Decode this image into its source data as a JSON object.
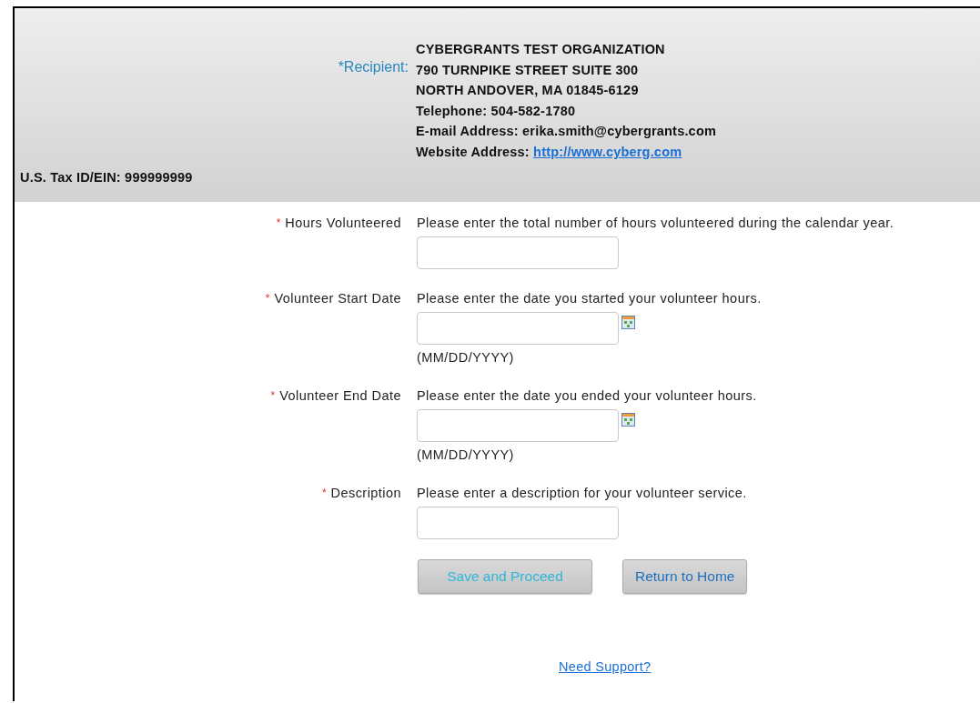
{
  "header": {
    "recipient_label": "*Recipient:",
    "address_lines": [
      "CYBERGRANTS TEST ORGANIZATION",
      "790 TURNPIKE STREET SUITE 300",
      "NORTH ANDOVER, MA 01845-6129",
      "Telephone: 504-582-1780",
      "E-mail Address: erika.smith@cybergrants.com"
    ],
    "website": {
      "label": "Website Address:",
      "link": "http://www.cyberg.com"
    },
    "tax_id": "U.S. Tax ID/EIN: 999999999"
  },
  "fields": [
    {
      "kind": "text",
      "required_mark": "*",
      "label": "Hours Volunteered",
      "instruction": "Please enter the total number of hours volunteered during the calendar year."
    },
    {
      "kind": "date",
      "required_mark": "*",
      "label": "Volunteer Start Date",
      "instruction": "Please enter the date you started your volunteer hours.",
      "format_hint": "(MM/DD/YYYY)"
    },
    {
      "kind": "date",
      "required_mark": "*",
      "label": "Volunteer End Date",
      "instruction": "Please enter the date you ended your volunteer hours.",
      "format_hint": "(MM/DD/YYYY)"
    },
    {
      "kind": "text",
      "required_mark": "*",
      "label": "Description",
      "instruction": "Please enter a description for your volunteer service."
    }
  ],
  "buttons": [
    {
      "label": "Save and Proceed",
      "disabled": true
    },
    {
      "label": "Return to Home",
      "disabled": false
    }
  ],
  "support_link": "Need Support?"
}
